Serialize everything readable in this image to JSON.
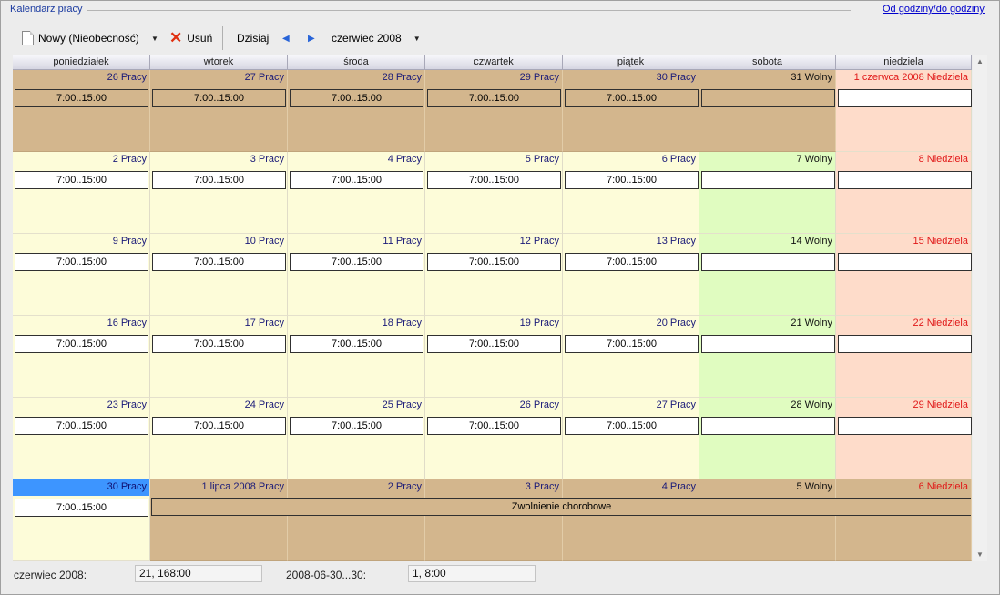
{
  "group_title": "Kalendarz pracy",
  "top_link": "Od godziny/do godziny",
  "toolbar": {
    "new_label": "Nowy (Nieobecność)",
    "delete_label": "Usuń",
    "today_label": "Dzisiaj",
    "month_label": "czerwiec 2008"
  },
  "weekdays": [
    "poniedziałek",
    "wtorek",
    "środa",
    "czwartek",
    "piątek",
    "sobota",
    "niedziela"
  ],
  "weeks": [
    [
      "26 Pracy",
      "27 Pracy",
      "28 Pracy",
      "29 Pracy",
      "30 Pracy",
      "31 Wolny",
      "1 czerwca 2008 Niedziela"
    ],
    [
      "2 Pracy",
      "3 Pracy",
      "4 Pracy",
      "5 Pracy",
      "6 Pracy",
      "7 Wolny",
      "8 Niedziela"
    ],
    [
      "9 Pracy",
      "10 Pracy",
      "11 Pracy",
      "12 Pracy",
      "13 Pracy",
      "14 Wolny",
      "15 Niedziela"
    ],
    [
      "16 Pracy",
      "17 Pracy",
      "18 Pracy",
      "19 Pracy",
      "20 Pracy",
      "21 Wolny",
      "22 Niedziela"
    ],
    [
      "23 Pracy",
      "24 Pracy",
      "25 Pracy",
      "26 Pracy",
      "27 Pracy",
      "28 Wolny",
      "29 Niedziela"
    ],
    [
      "30 Pracy",
      "1 lipca 2008 Pracy",
      "2 Pracy",
      "3 Pracy",
      "4 Pracy",
      "5 Wolny",
      "6 Niedziela"
    ]
  ],
  "work_hours": "7:00..15:00",
  "absence_label": "Zwolnienie chorobowe",
  "footer": {
    "month_label": "czerwiec 2008:",
    "month_value": "21, 168:00",
    "range_label": "2008-06-30...30:",
    "range_value": "1, 8:00"
  },
  "colors": {
    "work_day": "#fdfcd9",
    "free_day": "#e0fcc0",
    "sunday": "#fedcca",
    "other_month": "#d3b68d",
    "selected": "#3d95ff"
  }
}
